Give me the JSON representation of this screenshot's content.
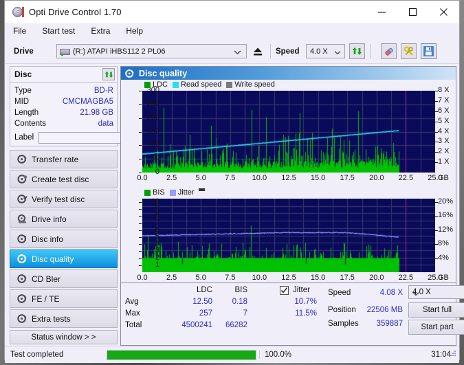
{
  "window": {
    "title": "Opti Drive Control 1.70",
    "minimize_label": "minimize-icon",
    "maximize_label": "maximize-icon",
    "close_label": "close-icon"
  },
  "menu": {
    "items": [
      "File",
      "Start test",
      "Extra",
      "Help"
    ]
  },
  "toolbar": {
    "drive_label": "Drive",
    "drive_value": "(R:)  ATAPI iHBS112  2 PL06",
    "eject_icon": "eject-icon",
    "speed_label": "Speed",
    "speed_value": "4.0 X",
    "refresh_icon": "refresh-icon",
    "eraser_icon": "eraser-icon",
    "wrench_icon": "tools-icon",
    "save_icon": "save-icon"
  },
  "disc": {
    "title": "Disc",
    "refresh_icon": "refresh-disc-icon",
    "rows": [
      {
        "key": "Type",
        "value": "BD-R"
      },
      {
        "key": "MID",
        "value": "CMCMAGBA5"
      },
      {
        "key": "Length",
        "value": "21.98 GB"
      },
      {
        "key": "Contents",
        "value": "data"
      }
    ],
    "label_key": "Label",
    "label_value": "",
    "label_placeholder": "",
    "disc_icon": "cd-icon"
  },
  "nav": {
    "items": [
      {
        "label": "Transfer rate",
        "icon": "disc-speed-icon",
        "selected": false
      },
      {
        "label": "Create test disc",
        "icon": "disc-burn-icon",
        "selected": false
      },
      {
        "label": "Verify test disc",
        "icon": "disc-verify-icon",
        "selected": false
      },
      {
        "label": "Drive info",
        "icon": "drive-info-icon",
        "selected": false
      },
      {
        "label": "Disc info",
        "icon": "disc-info-icon",
        "selected": false
      },
      {
        "label": "Disc quality",
        "icon": "disc-quality-icon",
        "selected": true
      },
      {
        "label": "CD Bler",
        "icon": "cd-bler-icon",
        "selected": false
      },
      {
        "label": "FE / TE",
        "icon": "fe-te-icon",
        "selected": false
      },
      {
        "label": "Extra tests",
        "icon": "extra-tests-icon",
        "selected": false
      }
    ],
    "status_window_label": "Status window > >"
  },
  "main": {
    "header_title": "Disc quality",
    "header_icon": "disc-quality-icon"
  },
  "stats": {
    "col_ldc": "LDC",
    "col_bis": "BIS",
    "col_jitter": "Jitter",
    "jitter_checked": true,
    "row_avg": "Avg",
    "row_max": "Max",
    "row_total": "Total",
    "ldc_avg": "12.50",
    "ldc_max": "257",
    "ldc_total": "4500241",
    "bis_avg": "0.18",
    "bis_max": "7",
    "bis_total": "66282",
    "jitter_avg": "10.7%",
    "jitter_max": "11.5%",
    "speed_label": "Speed",
    "speed_value": "4.08 X",
    "position_label": "Position",
    "position_value": "22506 MB",
    "samples_label": "Samples",
    "samples_value": "359887",
    "speed_select": "4.0 X",
    "start_full": "Start full",
    "start_part": "Start part"
  },
  "statusbar": {
    "text": "Test completed",
    "progress_percent": "100.0%",
    "progress_value": 100,
    "elapsed": "31:04"
  },
  "colors": {
    "ldc_green": "#00c000",
    "read_speed_cyan": "#26e0f0",
    "write_speed_gray": "#7b7b7b",
    "bis_green": "#00c000",
    "jitter_violet": "#9a9aff",
    "plot_bg": "#0a0a5a",
    "marker_magenta": "#b0228c",
    "accent_blue": "#2a2ad0"
  },
  "chart_data": [
    {
      "type": "bar",
      "id": "ldc-chart",
      "title": "",
      "xlabel": "GB",
      "ylabel": "",
      "xlim": [
        0,
        25
      ],
      "ylim": [
        0,
        300
      ],
      "y2lim": [
        0,
        8
      ],
      "y2label": "X",
      "xticks": [
        0.0,
        2.5,
        5.0,
        7.5,
        10.0,
        12.5,
        15.0,
        17.5,
        20.0,
        22.5,
        25.0
      ],
      "xticklabels": [
        "0.0",
        "2.5",
        "5.0",
        "7.5",
        "10.0",
        "12.5",
        "15.0",
        "17.5",
        "20.0",
        "22.5",
        "25.0"
      ],
      "yticks": [
        0,
        50,
        100,
        150,
        200,
        250,
        300
      ],
      "yticklabels": [
        "0",
        "50",
        "100",
        "150",
        "200",
        "250",
        "300"
      ],
      "y2ticks": [
        1,
        2,
        3,
        4,
        5,
        6,
        7,
        8
      ],
      "y2ticklabels": [
        "1 X",
        "2 X",
        "3 X",
        "4 X",
        "5 X",
        "6 X",
        "7 X",
        "8 X"
      ],
      "grid": true,
      "legend": [
        "LDC",
        "Read speed",
        "Write speed"
      ],
      "legend_position": "top-left",
      "data_end_gb": 21.9,
      "marker_gb": 22.5,
      "series": [
        {
          "name": "LDC",
          "kind": "bar",
          "color": "#00c000",
          "baseline_start": 30,
          "baseline_end": 42,
          "spike_mean": 75,
          "max": 257
        },
        {
          "name": "Read speed",
          "kind": "line",
          "color": "#26e0f0",
          "start_x_value": 1.8,
          "end_x_value": 4.1
        },
        {
          "name": "Write speed",
          "kind": "line",
          "color": "#7b7b7b",
          "values": []
        }
      ]
    },
    {
      "type": "bar",
      "id": "bis-chart",
      "title": "",
      "xlabel": "GB",
      "ylabel": "",
      "xlim": [
        0,
        25
      ],
      "ylim": [
        0,
        10
      ],
      "y2lim": [
        0,
        20
      ],
      "y2label": "%",
      "xticks": [
        0.0,
        2.5,
        5.0,
        7.5,
        10.0,
        12.5,
        15.0,
        17.5,
        20.0,
        22.5,
        25.0
      ],
      "xticklabels": [
        "0.0",
        "2.5",
        "5.0",
        "7.5",
        "10.0",
        "12.5",
        "15.0",
        "17.5",
        "20.0",
        "22.5",
        "25.0"
      ],
      "yticks": [
        1,
        2,
        3,
        4,
        5,
        6,
        7,
        8,
        9,
        10
      ],
      "yticklabels": [
        "1",
        "2",
        "3",
        "4",
        "5",
        "6",
        "7",
        "8",
        "9",
        "10"
      ],
      "y2ticks": [
        4,
        8,
        12,
        16,
        20
      ],
      "y2ticklabels": [
        "4%",
        "8%",
        "12%",
        "16%",
        "20%"
      ],
      "grid": true,
      "legend": [
        "BIS",
        "Jitter"
      ],
      "legend_position": "top-left",
      "data_end_gb": 21.9,
      "marker_gb": 22.5,
      "series": [
        {
          "name": "BIS",
          "kind": "bar",
          "color": "#00c000",
          "baseline": 2,
          "typical_max": 4,
          "max": 7
        },
        {
          "name": "Jitter",
          "kind": "line",
          "color": "#9a9aff",
          "percent_start": 10.4,
          "percent_mid": 11.3,
          "percent_end": 10.0
        }
      ]
    }
  ]
}
